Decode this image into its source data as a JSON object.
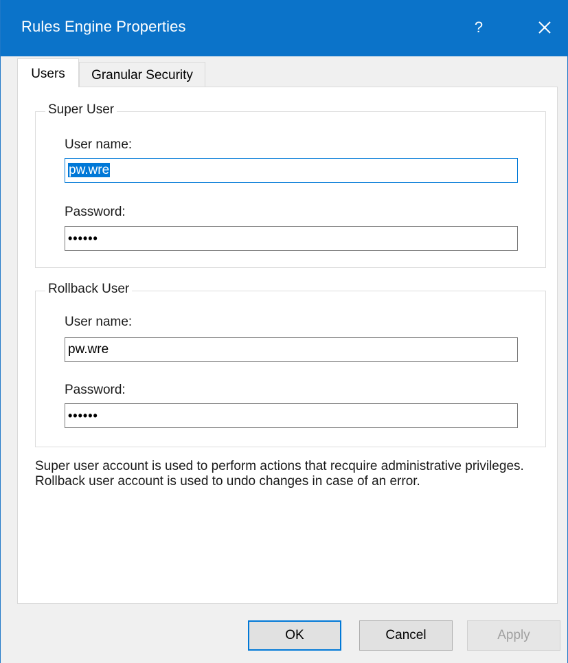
{
  "window": {
    "title": "Rules Engine Properties",
    "help_label": "?",
    "accent_color": "#0b73c9"
  },
  "tabs": [
    {
      "label": "Users",
      "selected": true
    },
    {
      "label": "Granular Security",
      "selected": false
    }
  ],
  "super_user": {
    "group_label": "Super User",
    "username_label": "User name:",
    "username_value": "pw.wre",
    "password_label": "Password:",
    "password_value": "••••••"
  },
  "rollback_user": {
    "group_label": "Rollback User",
    "username_label": "User name:",
    "username_value": "pw.wre",
    "password_label": "Password:",
    "password_value": "••••••"
  },
  "description": {
    "line1": "Super user account is used to perform actions that recquire administrative privileges.",
    "line2": "Rollback user account is used to undo changes in case of an error."
  },
  "buttons": {
    "ok": "OK",
    "cancel": "Cancel",
    "apply": "Apply"
  }
}
